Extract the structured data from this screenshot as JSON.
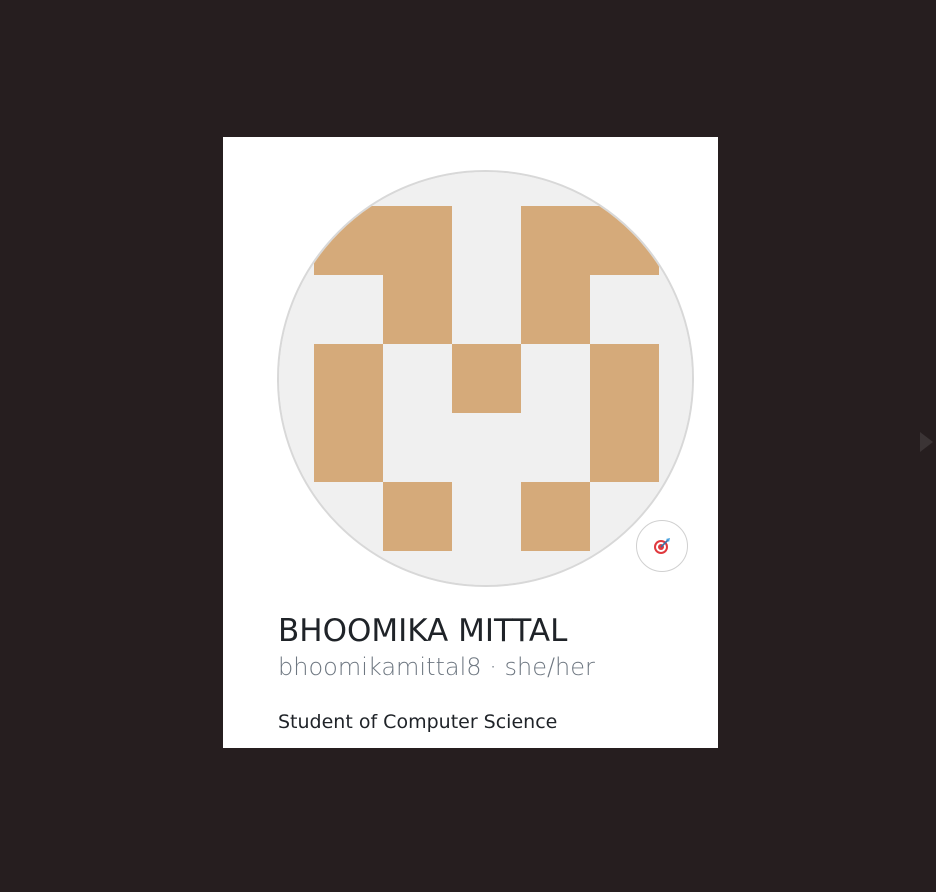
{
  "profile": {
    "name": "BHOOMIKA MITTAL",
    "username": "bhoomikamittal8",
    "separator": "·",
    "pronouns": "she/her",
    "bio": "Student of Computer Science"
  },
  "avatar": {
    "icon": "identicon",
    "background_color": "#f0f0f0",
    "block_color": "#d5aa7a"
  },
  "status": {
    "icon": "dart-target-icon"
  }
}
